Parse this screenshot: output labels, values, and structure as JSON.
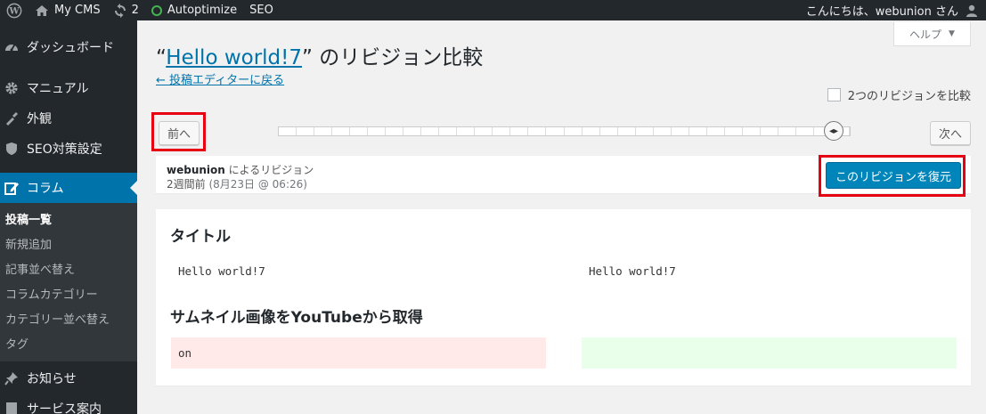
{
  "adminbar": {
    "site_name": "My CMS",
    "updates_count": "2",
    "autoptimize": "Autoptimize",
    "seo": "SEO",
    "greeting": "こんにちは、webunion さん"
  },
  "sidebar": {
    "items": [
      {
        "label": "ダッシュボード",
        "icon": "dashboard-icon"
      },
      {
        "label": "マニュアル",
        "icon": "gear-icon"
      },
      {
        "label": "外観",
        "icon": "paintbrush-icon"
      },
      {
        "label": "SEO対策設定",
        "icon": "shield-icon"
      },
      {
        "label": "コラム",
        "icon": "edit-icon"
      }
    ],
    "submenu": [
      "投稿一覧",
      "新規追加",
      "記事並べ替え",
      "コラムカテゴリー",
      "カテゴリー並べ替え",
      "タグ"
    ],
    "after_items": [
      {
        "label": "お知らせ",
        "icon": "pin-icon"
      },
      {
        "label": "サービス案内",
        "icon": "page-icon"
      }
    ]
  },
  "help": {
    "label": "ヘルプ"
  },
  "title": {
    "prefix": "“",
    "post_title": "Hello world!7",
    "suffix": "” のリビジョン比較"
  },
  "back_link": "← 投稿エディターに戻る",
  "compare_two_label": "2つのリビジョンを比較",
  "nav": {
    "prev": "前へ",
    "next": "次へ"
  },
  "slider": {
    "ticks": 32,
    "position": 0.96
  },
  "revision": {
    "author": "webunion",
    "author_suffix": " によるリビジョン",
    "ago": "2週間前",
    "date": " (8月23日 @ 06:26)",
    "restore": "このリビジョンを復元"
  },
  "diff": {
    "fields": [
      {
        "heading": "タイトル",
        "left": "Hello world!7",
        "right": "Hello world!7",
        "changed": false
      },
      {
        "heading": "サムネイル画像をYouTubeから取得",
        "left": "on",
        "right": "",
        "changed": true
      }
    ]
  },
  "colors": {
    "accent": "#0073aa",
    "highlight": "#e60012",
    "deleted": "#ffe9e9",
    "added": "#e9ffe9"
  }
}
